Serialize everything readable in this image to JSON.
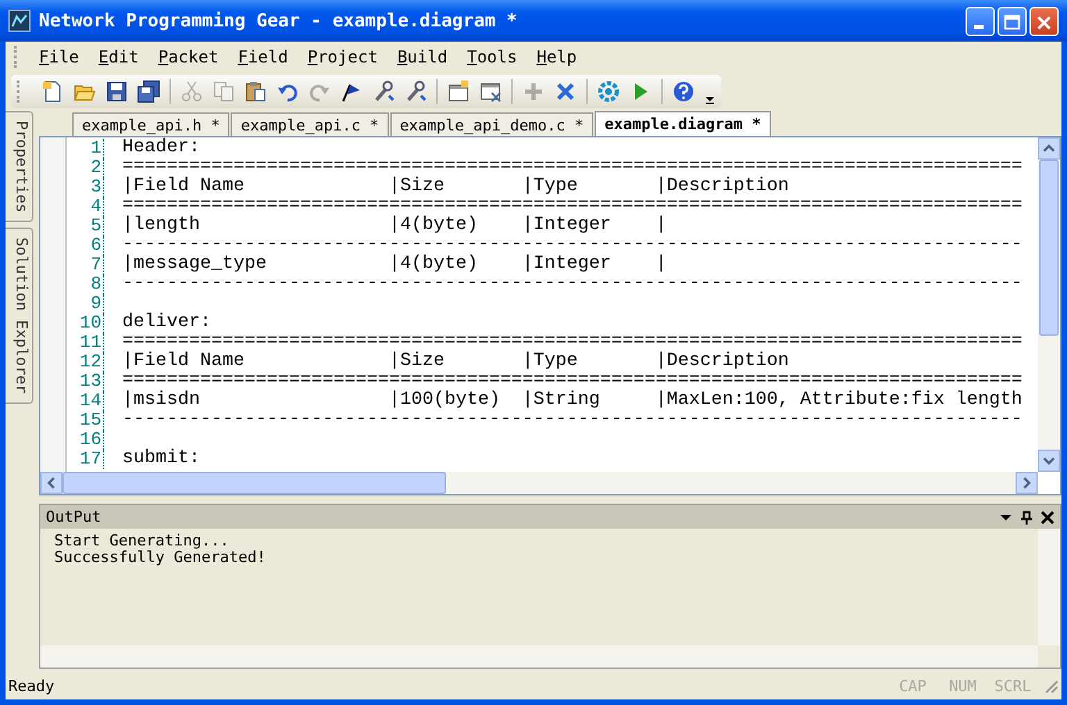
{
  "window": {
    "title": "Network Programming Gear - example.diagram *"
  },
  "menu": [
    "File",
    "Edit",
    "Packet",
    "Field",
    "Project",
    "Build",
    "Tools",
    "Help"
  ],
  "toolbar": [
    [
      {
        "kind": "new",
        "disabled": false
      },
      {
        "kind": "open",
        "disabled": false
      },
      {
        "kind": "save",
        "disabled": false
      },
      {
        "kind": "save-all",
        "disabled": false
      }
    ],
    [
      {
        "kind": "cut",
        "disabled": true
      },
      {
        "kind": "copy",
        "disabled": true
      },
      {
        "kind": "paste",
        "disabled": false
      },
      {
        "kind": "undo",
        "disabled": false
      },
      {
        "kind": "redo",
        "disabled": true
      },
      {
        "kind": "marker",
        "disabled": false
      },
      {
        "kind": "tool",
        "disabled": false
      },
      {
        "kind": "tool",
        "disabled": false
      }
    ],
    [
      {
        "kind": "window-new",
        "disabled": false
      },
      {
        "kind": "window-close",
        "disabled": false
      }
    ],
    [
      {
        "kind": "add",
        "disabled": true
      },
      {
        "kind": "remove",
        "disabled": false
      }
    ],
    [
      {
        "kind": "gear",
        "disabled": false
      },
      {
        "kind": "run",
        "disabled": false
      }
    ],
    [
      {
        "kind": "help",
        "disabled": false
      }
    ]
  ],
  "side_tabs": [
    "Properties",
    "Solution Explorer"
  ],
  "tabs": [
    {
      "label": "example_api.h *",
      "selected": false
    },
    {
      "label": "example_api.c *",
      "selected": false
    },
    {
      "label": "example_api_demo.c *",
      "selected": false
    },
    {
      "label": "example.diagram *",
      "selected": true
    }
  ],
  "editor": {
    "lines": [
      {
        "number": "1",
        "text": "Header:"
      },
      {
        "number": "2",
        "text": "================================================================================="
      },
      {
        "number": "3",
        "text": "|Field Name             |Size       |Type       |Description"
      },
      {
        "number": "4",
        "text": "================================================================================="
      },
      {
        "number": "5",
        "text": "|length                 |4(byte)    |Integer    |"
      },
      {
        "number": "6",
        "text": "---------------------------------------------------------------------------------"
      },
      {
        "number": "7",
        "text": "|message_type           |4(byte)    |Integer    |"
      },
      {
        "number": "8",
        "text": "---------------------------------------------------------------------------------"
      },
      {
        "number": "9"
      },
      {
        "number": "10",
        "text": "deliver:"
      },
      {
        "number": "11",
        "text": "================================================================================="
      },
      {
        "number": "12",
        "text": "|Field Name             |Size       |Type       |Description"
      },
      {
        "number": "13",
        "text": "================================================================================="
      },
      {
        "number": "14",
        "text": "|msisdn                 |100(byte)  |String     |MaxLen:100, Attribute:fix length"
      },
      {
        "number": "15",
        "text": "---------------------------------------------------------------------------------"
      },
      {
        "number": "16"
      },
      {
        "number": "17",
        "text": "submit:"
      }
    ]
  },
  "output": {
    "title": "OutPut",
    "lines": [
      "Start Generating...",
      "Successfully Generated!"
    ]
  },
  "status_bar": {
    "text": "Ready",
    "indicators": [
      {
        "label": "CAP",
        "on": false
      },
      {
        "label": "NUM",
        "on": false
      },
      {
        "label": "SCRL",
        "on": false
      }
    ]
  }
}
